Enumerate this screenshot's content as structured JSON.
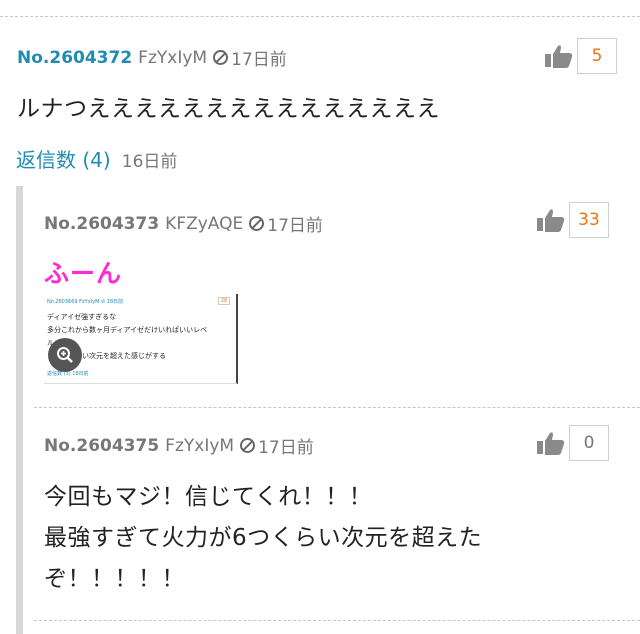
{
  "comment1": {
    "number": "No.2604372",
    "user_id": "FzYxIyM",
    "time": "17日前",
    "likes": "5",
    "text": "ルナつえええええええええええええええ",
    "replies_label": "返信数 (4)",
    "replies_time": "16日前"
  },
  "reply1": {
    "number": "No.2604373",
    "user_id": "KFZyAQE",
    "time": "17日前",
    "likes": "33",
    "text": "ふーん",
    "thumbnail": {
      "head": "No.2603669 FzYxIyM ⊘ 18日前",
      "likes": "28",
      "lines": [
        "ディアイゼ強すぎるな",
        "多分これから数ヶ月ディアイゼだけいればいいレベ",
        "ル",
        "くらい次元を超えた感じがする"
      ],
      "foot": "返信数 (3) 18日前"
    }
  },
  "reply2": {
    "number": "No.2604375",
    "user_id": "FzYxIyM",
    "time": "17日前",
    "likes": "0",
    "text_lines": [
      "今回もマジ！信じてくれ！！！",
      "最強すぎて火力が6つくらい次元を超えた",
      "ぞ！！！！！"
    ]
  },
  "colors": {
    "link_blue": "#1f8cb3",
    "like_orange": "#e8741a",
    "magenta": "#ff2ad4"
  }
}
